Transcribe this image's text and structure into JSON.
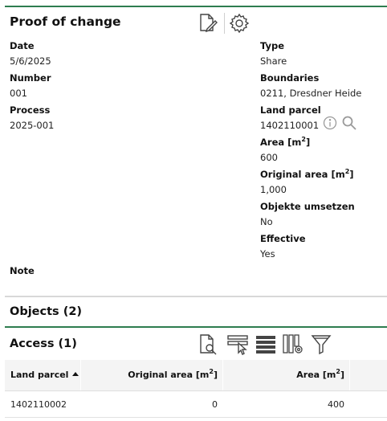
{
  "header": {
    "title": "Proof of change"
  },
  "left_fields": [
    {
      "label": "Date",
      "value": "5/6/2025"
    },
    {
      "label": "Number",
      "value": "001"
    },
    {
      "label": "Process",
      "value": "2025-001"
    }
  ],
  "right_fields": {
    "type": {
      "label": "Type",
      "value": "Share"
    },
    "boundaries": {
      "label": "Boundaries",
      "value": "0211, Dresdner Heide"
    },
    "land_parcel": {
      "label": "Land parcel",
      "value": "1402110001"
    },
    "area": {
      "label": "Area [m",
      "sup": "2",
      "tail": "]",
      "value": "600"
    },
    "original_area": {
      "label": "Original area [m",
      "sup": "2",
      "tail": "]",
      "value": "1,000"
    },
    "objekte": {
      "label": "Objekte umsetzen",
      "value": "No"
    },
    "effective": {
      "label": "Effective",
      "value": "Yes"
    }
  },
  "note": {
    "label": "Note"
  },
  "objects": {
    "title": "Objects (2)"
  },
  "access": {
    "title": "Access (1)",
    "columns": {
      "land_parcel": "Land parcel",
      "original_area": "Original area [m",
      "area": "Area [m",
      "sup": "2",
      "tail": "]"
    },
    "rows": [
      {
        "land_parcel": "1402110002",
        "original_area": "0",
        "area": "400"
      }
    ]
  },
  "colors": {
    "accent": "#2e7d4f",
    "icon": "#444444",
    "muted_icon": "#9a9a9a"
  }
}
